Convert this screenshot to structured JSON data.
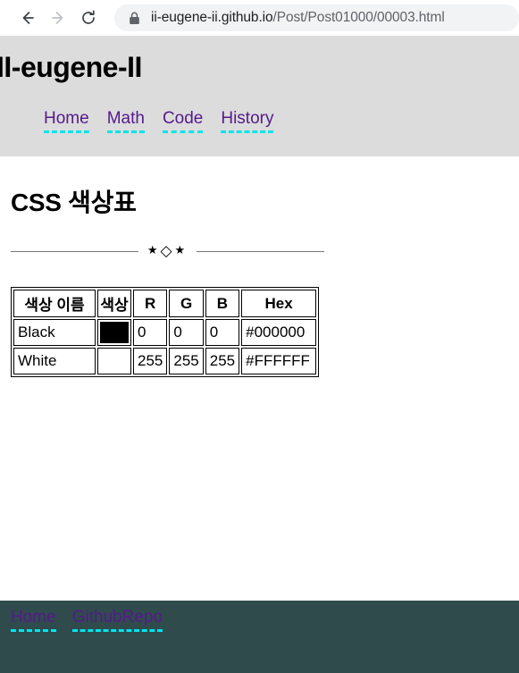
{
  "browser": {
    "back_icon": "arrow-left-icon",
    "forward_icon": "arrow-right-icon",
    "reload_icon": "reload-icon",
    "lock_icon": "lock-icon",
    "url_domain": "ii-eugene-ii.github.io",
    "url_path": "/Post/Post01000/00003.html"
  },
  "header": {
    "site_title": "II-eugene-II",
    "nav": [
      {
        "label": "Home"
      },
      {
        "label": "Math"
      },
      {
        "label": "Code"
      },
      {
        "label": "History"
      }
    ]
  },
  "main": {
    "post_title": "CSS 색상표",
    "divider_marks": "★",
    "divider_diamond": "◇"
  },
  "table": {
    "headers": [
      "색상 이름",
      "색상",
      "R",
      "G",
      "B",
      "Hex"
    ],
    "rows": [
      {
        "name": "Black",
        "swatch": "#000000",
        "r": "0",
        "g": "0",
        "b": "0",
        "hex": "#000000"
      },
      {
        "name": "White",
        "swatch": "#FFFFFF",
        "r": "255",
        "g": "255",
        "b": "255",
        "hex": "#FFFFFF"
      }
    ]
  },
  "footer": {
    "links": [
      {
        "label": "Home"
      },
      {
        "label": "GithubRepo"
      }
    ],
    "background": "#2F4B4C"
  },
  "colors": {
    "header_band": "#DCDCDC",
    "link": "#551A8B",
    "link_underline": "#00E5EE"
  }
}
